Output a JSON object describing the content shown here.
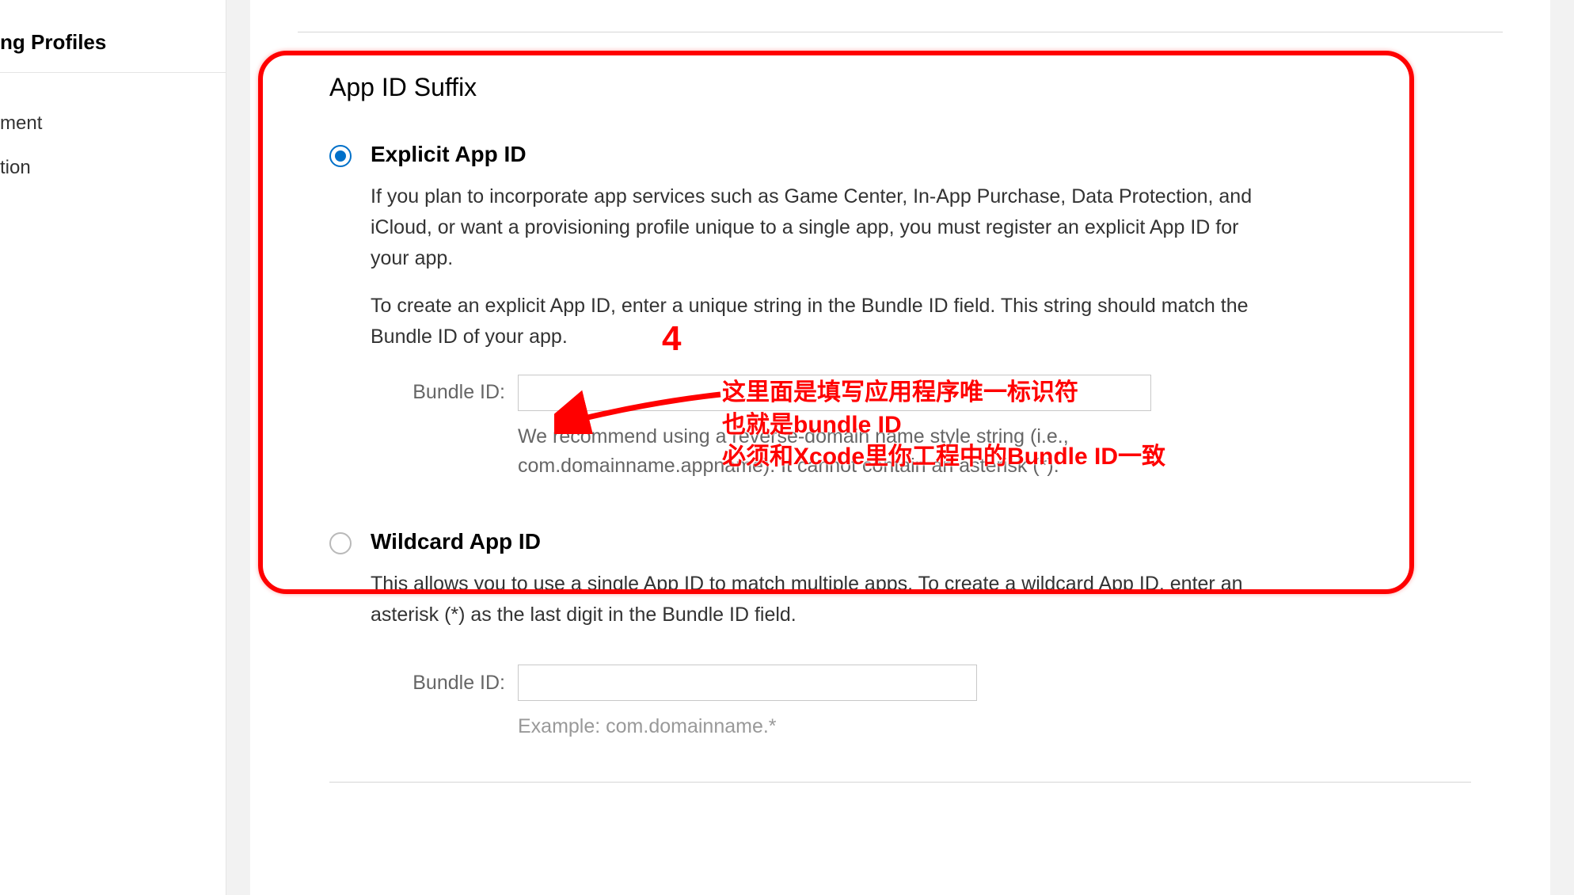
{
  "sidebar": {
    "header": "ng Profiles",
    "items": [
      {
        "label": "ment"
      },
      {
        "label": "tion"
      }
    ]
  },
  "section": {
    "title": "App ID Suffix"
  },
  "explicit": {
    "title": "Explicit App ID",
    "desc1": "If you plan to incorporate app services such as Game Center, In-App Purchase, Data Protection, and iCloud, or want a provisioning profile unique to a single app, you must register an explicit App ID for your app.",
    "desc2": "To create an explicit App ID, enter a unique string in the Bundle ID field. This string should match the Bundle ID of your app.",
    "bundle_label": "Bundle ID:",
    "bundle_hint": "We recommend using a reverse-domain name style string (i.e., com.domainname.appname). It cannot contain an asterisk (*)."
  },
  "wildcard": {
    "title": "Wildcard App ID",
    "desc": "This allows you to use a single App ID to match multiple apps. To create a wildcard App ID, enter an asterisk (*) as the last digit in the Bundle ID field.",
    "bundle_label": "Bundle ID:",
    "example": "Example: com.domainname.*"
  },
  "annotations": {
    "step": "4",
    "line1": "这里面是填写应用程序唯一标识符",
    "line2": "也就是bundle ID",
    "line3": "必须和Xcode里你工程中的Bundle ID一致"
  }
}
